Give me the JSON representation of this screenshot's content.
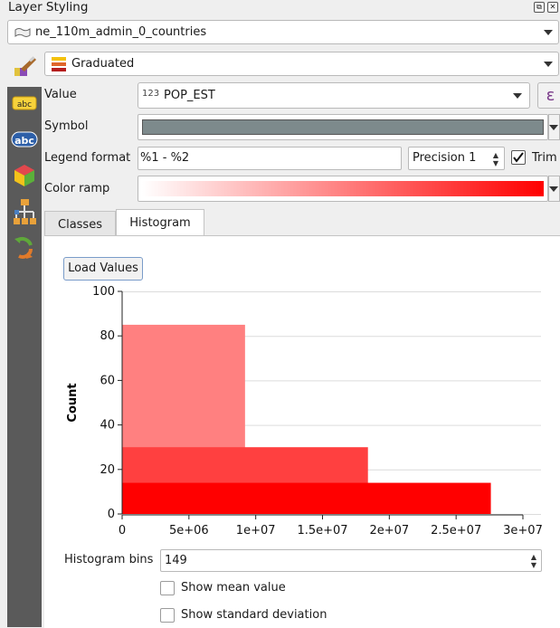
{
  "panel": {
    "title": "Layer Styling"
  },
  "layer_combo": {
    "value": "ne_110m_admin_0_countries"
  },
  "renderer_combo": {
    "value": "Graduated"
  },
  "sidebar": {
    "icons": [
      "labels-icon",
      "abc-icon",
      "3d-cube-icon",
      "diagram-icon",
      "history-icon"
    ]
  },
  "form": {
    "value_label": "Value",
    "value_type_badge": "123",
    "value_field": "POP_EST",
    "expression_symbol": "ε",
    "symbol_label": "Symbol",
    "symbol_color": "#7d8a8c",
    "legend_format_label": "Legend format",
    "legend_format_value": "%1 - %2",
    "precision_value": "Precision 1",
    "trim_label": "Trim",
    "trim_checked": true,
    "color_ramp_label": "Color ramp",
    "ramp_start": "#ffffff",
    "ramp_end": "#ff0000"
  },
  "tabs": {
    "classes": "Classes",
    "histogram": "Histogram",
    "active": "Histogram"
  },
  "histogram": {
    "load_values_label": "Load Values",
    "bins_label": "Histogram bins",
    "bins_value": "149",
    "show_mean_label": "Show mean value",
    "show_stddev_label": "Show standard deviation",
    "show_mean_checked": false,
    "show_stddev_checked": false
  },
  "chart_data": {
    "type": "bar",
    "ylabel": "Count",
    "xlabel": "",
    "xlim": [
      0,
      30000000
    ],
    "ylim": [
      0,
      100
    ],
    "x_ticks": [
      "0",
      "5e+06",
      "1e+07",
      "1.5e+07",
      "2e+07",
      "2.5e+07",
      "3e+07"
    ],
    "x_tick_values": [
      0,
      5000000,
      10000000,
      15000000,
      20000000,
      25000000,
      30000000
    ],
    "y_ticks": [
      0,
      20,
      40,
      60,
      80,
      100
    ],
    "bars": [
      {
        "x0": 0,
        "x1": 9200000,
        "value": 85,
        "color": "#ff8080"
      },
      {
        "x0": 0,
        "x1": 18400000,
        "value": 30,
        "color": "#ff4040"
      },
      {
        "x0": 0,
        "x1": 27600000,
        "value": 14,
        "color": "#ff0000"
      }
    ],
    "grid": true
  }
}
